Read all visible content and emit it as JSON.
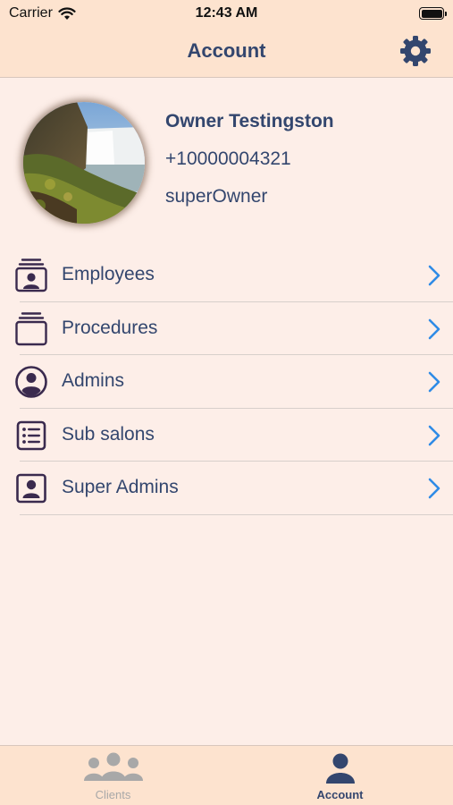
{
  "status_bar": {
    "carrier": "Carrier",
    "time": "12:43 AM",
    "icons": [
      "wifi-icon",
      "battery-icon"
    ]
  },
  "nav": {
    "title": "Account",
    "settings_icon": "gear-icon"
  },
  "profile": {
    "name": "Owner Testingston",
    "phone": "+10000004321",
    "role": "superOwner",
    "avatar": "waterfall-photo"
  },
  "menu": {
    "items": [
      {
        "label": "Employees",
        "icon": "employee-card-stack-icon"
      },
      {
        "label": "Procedures",
        "icon": "card-stack-icon"
      },
      {
        "label": "Admins",
        "icon": "person-circle-icon"
      },
      {
        "label": "Sub salons",
        "icon": "list-icon"
      },
      {
        "label": "Super Admins",
        "icon": "person-card-icon"
      }
    ]
  },
  "tabs": [
    {
      "label": "Clients",
      "icon": "people-group-icon",
      "selected": false
    },
    {
      "label": "Account",
      "icon": "person-icon",
      "selected": true
    }
  ],
  "colors": {
    "background": "#fdeee8",
    "bar_background": "#fde3cf",
    "text_primary": "#33466e",
    "chevron": "#2f8be6",
    "icon_dark": "#3a2a4e",
    "tab_inactive": "#a8a8a8"
  }
}
